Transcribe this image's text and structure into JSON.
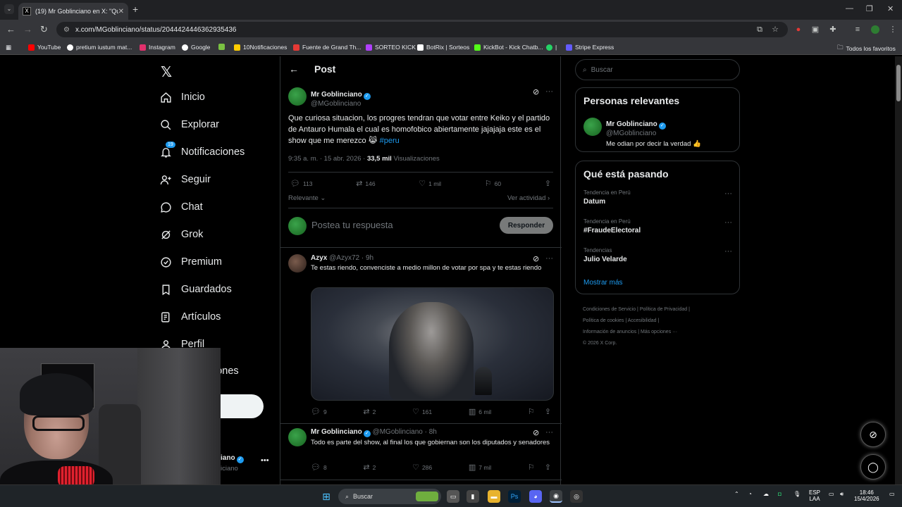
{
  "browser": {
    "tab_title": "(19) Mr Goblinciano en X: \"Que",
    "tab_favicon": "X",
    "url": "x.com/MGoblinciano/status/2044424446362935436",
    "bookmarks": [
      {
        "label": "YouTube",
        "color": "#ff0000"
      },
      {
        "label": "pretium iustum mat...",
        "color": "#ffffff"
      },
      {
        "label": "Instagram",
        "color": "#e1306c"
      },
      {
        "label": "Google",
        "color": "#4285f4"
      },
      {
        "label": "",
        "color": "#7ac142"
      },
      {
        "label": "10Notificaciones",
        "color": "#ffcc00"
      },
      {
        "label": "Fuente de Grand Th...",
        "color": "#e53935"
      },
      {
        "label": "SORTEO KICK",
        "color": "#b040ff"
      },
      {
        "label": "BotRix | Sorteos",
        "color": "#ffffff"
      },
      {
        "label": "KickBot - Kick Chatb...",
        "color": "#53fc18"
      },
      {
        "label": "|",
        "color": "#25d366"
      },
      {
        "label": "Stripe Express",
        "color": "#635bff"
      }
    ],
    "all_bookmarks": "Todos los favoritos"
  },
  "nav": {
    "items": [
      {
        "label": "Inicio",
        "icon": "home-icon"
      },
      {
        "label": "Explorar",
        "icon": "search-icon"
      },
      {
        "label": "Notificaciones",
        "icon": "bell-icon",
        "badge": "19"
      },
      {
        "label": "Seguir",
        "icon": "follow-icon"
      },
      {
        "label": "Chat",
        "icon": "chat-icon"
      },
      {
        "label": "Grok",
        "icon": "grok-icon"
      },
      {
        "label": "Premium",
        "icon": "premium-icon"
      },
      {
        "label": "Guardados",
        "icon": "bookmark-icon"
      },
      {
        "label": "Artículos",
        "icon": "articles-icon"
      },
      {
        "label": "Perfil",
        "icon": "person-icon"
      }
    ],
    "more_partial": "iones",
    "post_partial": "r",
    "account_name_partial": "iano",
    "account_handle_partial": "iciano"
  },
  "post": {
    "header": "Post",
    "author": "Mr Goblinciano",
    "handle": "@MGoblinciano",
    "text": "Que curiosa situacion, los progres tendran que votar entre Keiko y el partido de Antauro Humala el cual es homofobico abiertamente jajajaja este es el show que me merezco",
    "emoji": "😹",
    "hashtag": "#peru",
    "time": "9:35 a. m. · 15 abr. 2026 · ",
    "views_count": "33,5 mil",
    "views_label": " Visualizaciones",
    "replies": "113",
    "reposts": "146",
    "likes": "1 mil",
    "bookmarks": "60",
    "sort": "Relevante",
    "activity": "Ver actividad",
    "reply_placeholder": "Postea tu respuesta",
    "reply_button": "Responder"
  },
  "replies": [
    {
      "author": "Azyx",
      "handle": "@Azyx72 · 9h",
      "text": "Te estas riendo, convenciste a medio millon de votar por spa y te estas riendo",
      "replies": "9",
      "reposts": "2",
      "likes": "161",
      "views": "6 mil"
    },
    {
      "author": "Mr Goblinciano",
      "handle": "@MGoblinciano · 8h",
      "text": "Todo es parte del show, al final los que gobiernan son los diputados y senadores",
      "replies": "8",
      "reposts": "2",
      "likes": "286",
      "views": "7 mil"
    }
  ],
  "sidebar": {
    "search_placeholder": "Buscar",
    "relevant_title": "Personas relevantes",
    "relevant_name": "Mr Goblinciano",
    "relevant_handle": "@MGoblinciano",
    "relevant_bio": "Me odian por decir la verdad 👍",
    "trends_title": "Qué está pasando",
    "trends": [
      {
        "context": "Tendencia en Perú",
        "name": "Datum"
      },
      {
        "context": "Tendencia en Perú",
        "name": "#FraudeElectoral"
      },
      {
        "context": "Tendencias",
        "name": "Julio Velarde"
      }
    ],
    "show_more": "Mostrar más",
    "footer_links": [
      "Condiciones de Servicio",
      "Política de Privacidad",
      "Política de cookies",
      "Accesibilidad",
      "Información de anuncios",
      "Más opciones ···"
    ],
    "copyright": "© 2026 X Corp."
  },
  "taskbar": {
    "search": "Buscar",
    "lang": "ESP",
    "lang2": "LAA",
    "time": "18:46",
    "date": "15/4/2026"
  }
}
